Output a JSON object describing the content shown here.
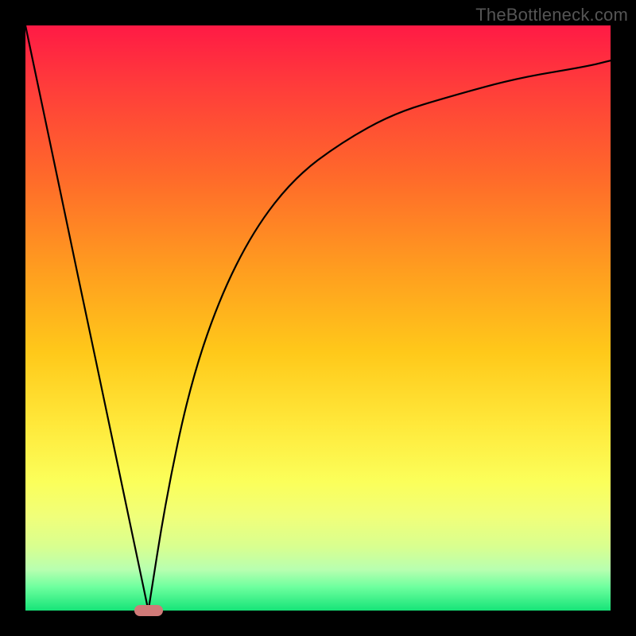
{
  "watermark": "TheBottleneck.com",
  "colors": {
    "frame_bg": "#000000",
    "gradient_top": "#ff1a45",
    "gradient_bottom": "#16e478",
    "curve_stroke": "#000000",
    "marker_fill": "#d07a78"
  },
  "chart_data": {
    "type": "line",
    "title": "",
    "xlabel": "",
    "ylabel": "",
    "xlim": [
      0,
      1
    ],
    "ylim": [
      0,
      1
    ],
    "x_anchor": 0.21,
    "series": [
      {
        "name": "left-leg",
        "x": [
          0.0,
          0.03,
          0.06,
          0.09,
          0.12,
          0.15,
          0.18,
          0.2,
          0.21
        ],
        "y": [
          1.0,
          0.857,
          0.714,
          0.571,
          0.429,
          0.286,
          0.143,
          0.048,
          0.0
        ]
      },
      {
        "name": "right-curve",
        "x": [
          0.21,
          0.24,
          0.28,
          0.33,
          0.39,
          0.46,
          0.54,
          0.63,
          0.73,
          0.84,
          0.96,
          1.0
        ],
        "y": [
          0.0,
          0.19,
          0.38,
          0.53,
          0.65,
          0.74,
          0.8,
          0.85,
          0.88,
          0.91,
          0.93,
          0.94
        ]
      }
    ],
    "marker": {
      "x": 0.21,
      "y": 0.0,
      "shape": "pill"
    },
    "notes": "Gradient background red→green top→bottom; black V-shaped curve with minimum at x≈0.21; small rounded marker at the minimum on the baseline."
  }
}
